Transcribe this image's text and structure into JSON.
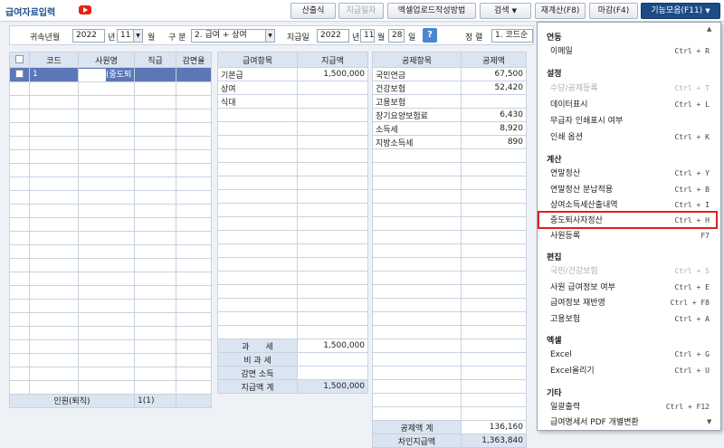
{
  "app": {
    "title": "급여자료입력"
  },
  "toolbar": {
    "b1": "산출식",
    "b2": "지급일자",
    "b3": "엑셀업로드작성방법",
    "b4": "검색",
    "b5": "재계산(F8)",
    "b6": "마감(F4)",
    "b7": "기능모음(F11)"
  },
  "filters": {
    "year_month_label": "귀속년월",
    "year": "2022",
    "year_unit": "년",
    "month": "11",
    "month_unit": "월",
    "type_label": "구 분",
    "type_value": "2. 급여 + 상여",
    "pay_date_label": "지급일",
    "pay_year": "2022",
    "pay_year_unit": "년",
    "pay_month": "11",
    "pay_month_unit": "월",
    "pay_day": "28",
    "pay_day_unit": "일",
    "sort_label": "정 렬",
    "sort_value": "1. 코드순"
  },
  "employees": {
    "headers": [
      "코드",
      "사원명",
      "직급",
      "감면율"
    ],
    "rows": [
      {
        "code": "1",
        "name": "",
        "name_tag": "(중도퇴",
        "grade": "",
        "rate": ""
      }
    ],
    "footer_label": "인원(퇴직)",
    "footer_count": "1(1)"
  },
  "payments": {
    "headers": [
      "급여항목",
      "지급액"
    ],
    "rows": [
      {
        "item": "기본급",
        "amount": "1,500,000"
      },
      {
        "item": "상여",
        "amount": ""
      },
      {
        "item": "식대",
        "amount": ""
      }
    ],
    "summary": [
      {
        "label": "과　　세",
        "amount": "1,500,000"
      },
      {
        "label": "비 과 세",
        "amount": ""
      },
      {
        "label": "감면 소득",
        "amount": ""
      },
      {
        "label": "지급액 계",
        "amount": "1,500,000"
      }
    ]
  },
  "deductions": {
    "headers": [
      "공제항목",
      "공제액"
    ],
    "rows": [
      {
        "item": "국민연금",
        "amount": "67,500"
      },
      {
        "item": "건강보험",
        "amount": "52,420"
      },
      {
        "item": "고용보험",
        "amount": ""
      },
      {
        "item": "장기요양보험료",
        "amount": "6,430"
      },
      {
        "item": "소득세",
        "amount": "8,920"
      },
      {
        "item": "지방소득세",
        "amount": "890"
      }
    ],
    "summary": [
      {
        "label": "공제액 계",
        "amount": "136,160"
      },
      {
        "label": "차인지급액",
        "amount": "1,363,840"
      }
    ]
  },
  "menu": {
    "s1": "연동",
    "i_email": {
      "label": "이메일",
      "shortcut": "Ctrl + R"
    },
    "s2": "설정",
    "i_allowance": {
      "label": "수당/공제등록",
      "shortcut": "Ctrl + T"
    },
    "i_dataview": {
      "label": "데이터표시",
      "shortcut": "Ctrl + L"
    },
    "i_noincome": {
      "label": "무급자 인쇄표시 여부",
      "shortcut": ""
    },
    "i_printopt": {
      "label": "인쇄 옵션",
      "shortcut": "Ctrl + K"
    },
    "s3": "계산",
    "i_yearend": {
      "label": "연말정산",
      "shortcut": "Ctrl + Y"
    },
    "i_yearend_split": {
      "label": "연말정산 분납적용",
      "shortcut": "Ctrl + B"
    },
    "i_bonus_tax": {
      "label": "상여소득세산출내역",
      "shortcut": "Ctrl + I"
    },
    "i_midterm": {
      "label": "중도퇴사자정산",
      "shortcut": "Ctrl + H"
    },
    "i_empreg": {
      "label": "사원등록",
      "shortcut": "F7"
    },
    "s4": "편집",
    "i_pension": {
      "label": "국민/건강보험",
      "shortcut": "Ctrl + S"
    },
    "i_payinfo": {
      "label": "사원 급여정보 여부",
      "shortcut": "Ctrl + E"
    },
    "i_reapply": {
      "label": "급여정보 재반영",
      "shortcut": "Ctrl + F8"
    },
    "i_employins": {
      "label": "고용보험",
      "shortcut": "Ctrl + A"
    },
    "s5": "엑셀",
    "i_excel": {
      "label": "Excel",
      "shortcut": "Ctrl + G"
    },
    "i_excel_up": {
      "label": "Excel올리기",
      "shortcut": "Ctrl + U"
    },
    "s6": "기타",
    "i_batchprint": {
      "label": "일괄출력",
      "shortcut": "Ctrl + F12"
    },
    "i_pdf": {
      "label": "급여명세서 PDF 개별변환",
      "shortcut": ""
    }
  },
  "colors": {
    "accent": "#1d4b86",
    "highlight": "#e02020",
    "selected_row": "#5b77b8"
  }
}
